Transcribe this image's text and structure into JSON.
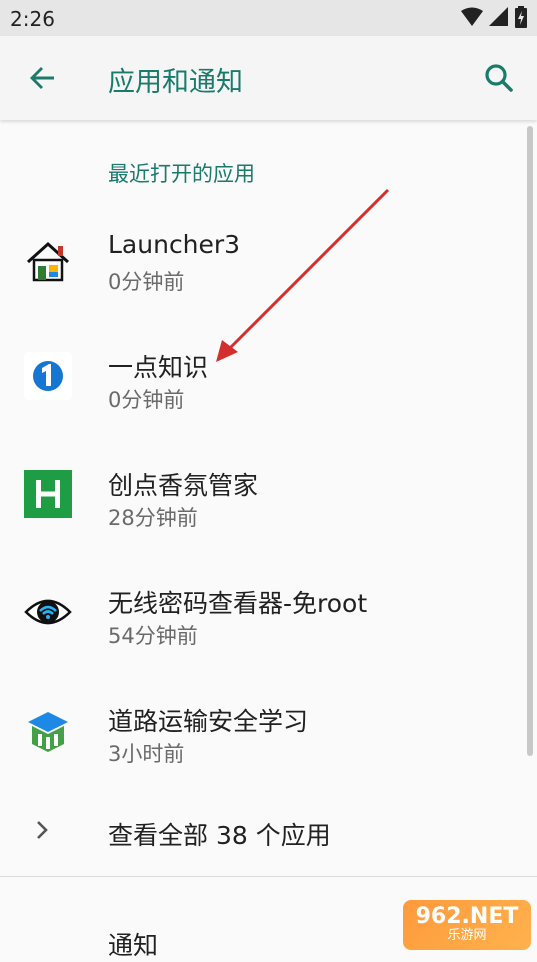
{
  "status_bar": {
    "time": "2:26"
  },
  "app_bar": {
    "title": "应用和通知"
  },
  "recent": {
    "header": "最近打开的应用",
    "apps": [
      {
        "name": "Launcher3",
        "time": "0分钟前"
      },
      {
        "name": "一点知识",
        "time": "0分钟前"
      },
      {
        "name": "创点香氛管家",
        "time": "28分钟前"
      },
      {
        "name": "无线密码查看器-免root",
        "time": "54分钟前"
      },
      {
        "name": "道路运输安全学习",
        "time": "3小时前"
      }
    ]
  },
  "see_all": {
    "label": "查看全部 38 个应用"
  },
  "notifications": {
    "label": "通知"
  },
  "watermark": {
    "top": "962.NET",
    "bottom": "乐游网"
  },
  "colors": {
    "accent": "#1a7b6b",
    "annotation_arrow": "#d32f2f"
  }
}
